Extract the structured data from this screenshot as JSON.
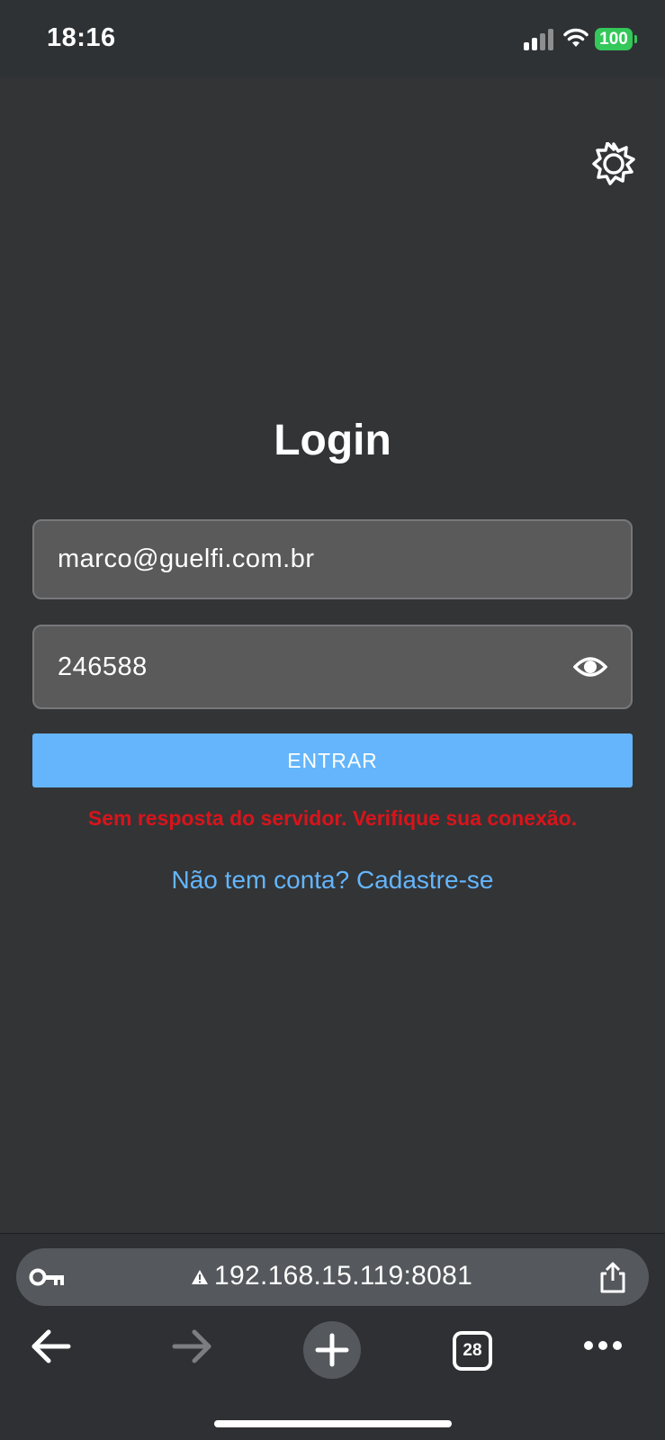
{
  "status_bar": {
    "time": "18:16",
    "battery": "100",
    "icons": [
      "signal-icon",
      "wifi-icon",
      "battery-icon"
    ]
  },
  "theme_toggle": {
    "icon": "sun-icon"
  },
  "login": {
    "title": "Login",
    "email_value": "marco@guelfi.com.br",
    "password_value": "246588",
    "password_toggle_icon": "eye-icon",
    "submit_label": "ENTRAR",
    "error_message": "Sem resposta do servidor. Verifique sua conexão.",
    "signup_link": "Não tem conta? Cadastre-se"
  },
  "browser": {
    "url": "192.168.15.119:8081",
    "tab_count": "28",
    "icons": [
      "key-icon",
      "warning-icon",
      "share-icon",
      "back-arrow-icon",
      "forward-arrow-icon",
      "plus-icon",
      "tabs-icon",
      "more-icon"
    ]
  },
  "colors": {
    "background": "#333436",
    "accent": "#64b5fb",
    "error": "#d9141b",
    "battery": "#34c759"
  }
}
